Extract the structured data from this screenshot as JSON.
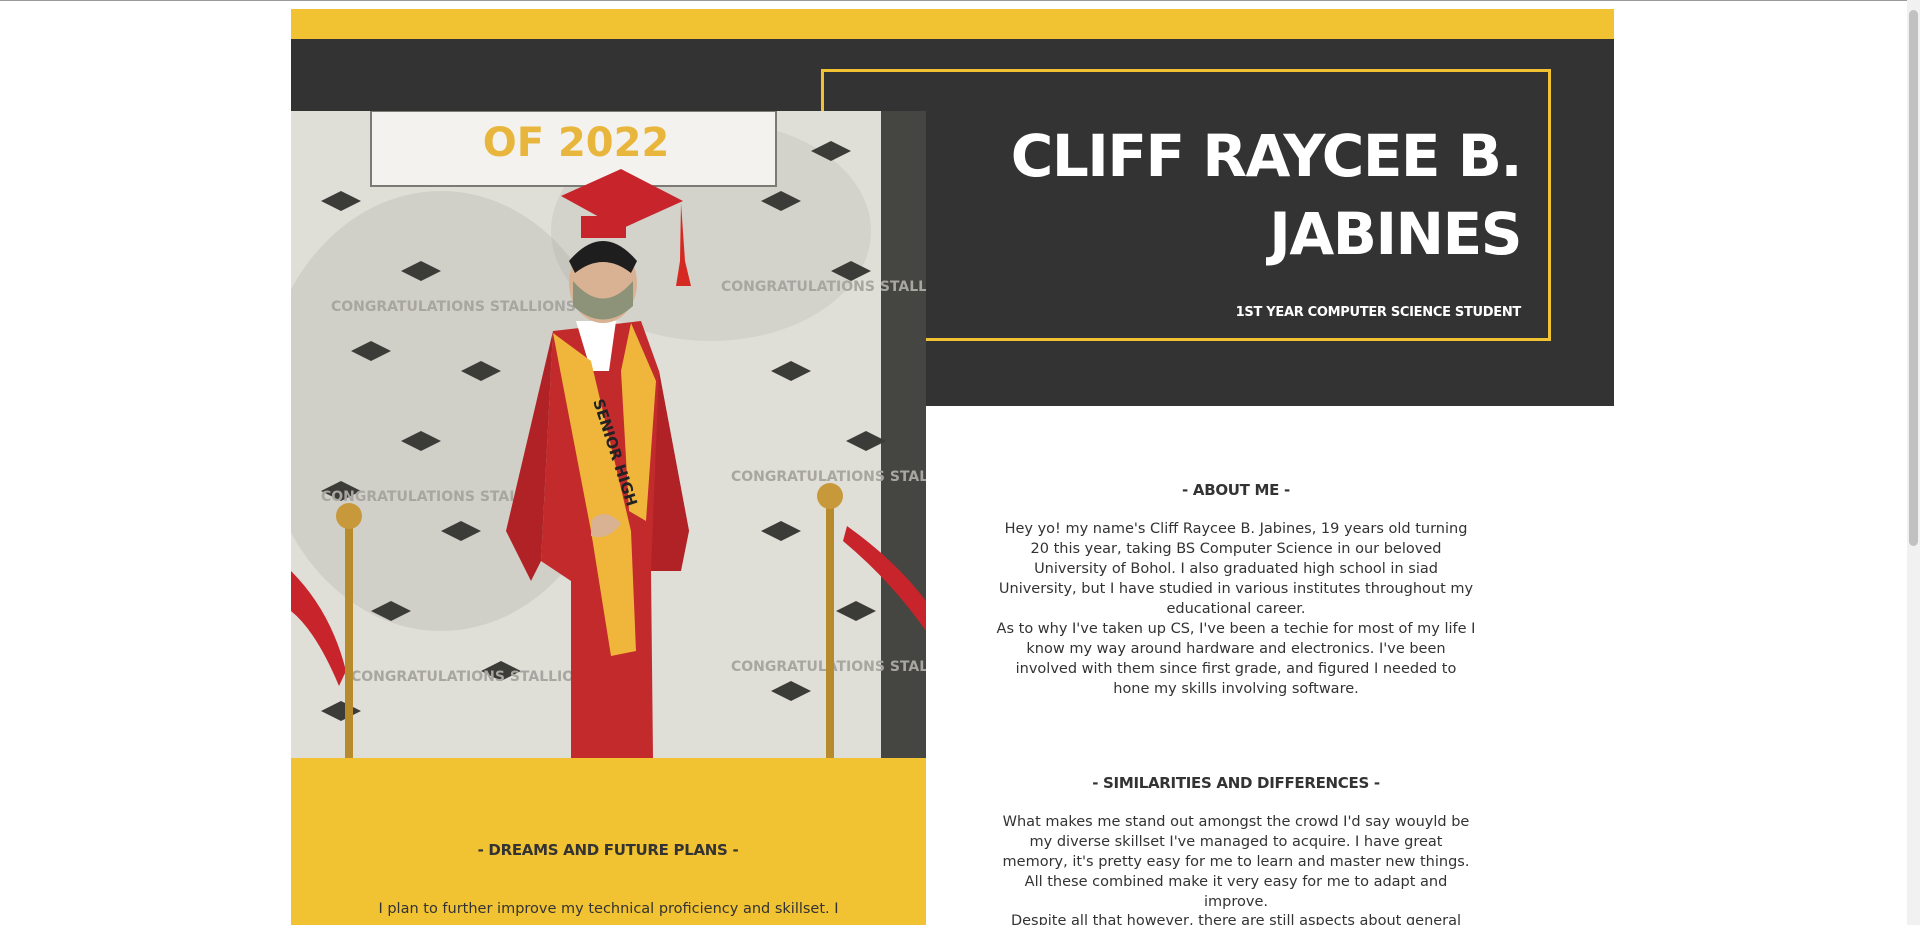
{
  "header": {
    "name": "CLIFF RAYCEE B. JABINES",
    "subtitle": "1ST YEAR COMPUTER SCIENCE STUDENT"
  },
  "photo": {
    "alt": "Graduation photo",
    "banner_text": "OF 2022",
    "backdrop_text": "CONGRATULATIONS STALLIONS!",
    "sash_text": "SENIOR HIGH"
  },
  "about": {
    "heading": "- ABOUT ME -",
    "paragraph1": "Hey yo! my name's Cliff Raycee B. Jabines, 19 years old turning 20 this year, taking BS Computer Science in our beloved University of Bohol. I also graduated high school in siad University, but I have studied in various institutes throughout my educational career.",
    "paragraph2": "As to why I've taken up CS, I've been a techie for most of my life I know my way around hardware and electronics. I've been involved with them since first grade, and figured I needed to hone my skills involving software."
  },
  "similarities": {
    "heading": "- SIMILARITIES AND DIFFERENCES -",
    "paragraph1": "What makes me stand out amongst the crowd I'd say wouyld be my diverse skillset I've managed to acquire. I have great memory, it's pretty easy for me to learn and master new things. All these combined make it very easy for me to adapt and improve.",
    "paragraph2": "Despite all that however, there are still aspects about general concerns"
  },
  "dreams": {
    "heading": "- DREAMS AND FUTURE PLANS -",
    "paragraph1": "I plan to further improve my technical proficiency and skillset. I"
  },
  "colors": {
    "accent": "#f1c232",
    "dark": "#333333",
    "text": "#333333",
    "background": "#ffffff"
  }
}
